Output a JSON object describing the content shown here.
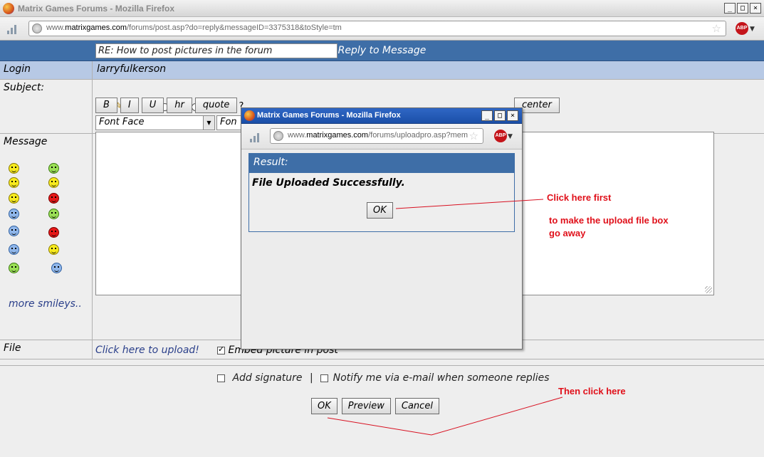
{
  "window": {
    "title": "Matrix Games Forums - Mozilla Firefox",
    "url_prefix": "www.",
    "url_domain": "matrixgames.com",
    "url_path": "/forums/post.asp?do=reply&messageID=3375318&toStyle=tm",
    "min_label": "_",
    "max_label": "□",
    "close_label": "×",
    "star_icon": "star-icon",
    "abp_label": "ABP"
  },
  "header": {
    "title": "Reply to Message"
  },
  "form": {
    "login_label": "Login",
    "login_value": "larryfulkerson",
    "subject_label": "Subject:",
    "subject_value": "RE: How to post pictures in the forum",
    "message_label": "Message",
    "toolbar": {
      "bold": "B",
      "italic": "I",
      "underline": "U",
      "hr": "hr",
      "quote": "quote",
      "center": "center"
    },
    "font_face": "Font Face",
    "font_size_partial": "Fon",
    "more_smileys": "more smileys..",
    "file_label": "File",
    "upload_link": "Click here to upload!",
    "embed_label": "Embed picture in post",
    "embed_checked": true,
    "signature_label": "Add signature",
    "separator": "|",
    "notify_label": "Notify me via e-mail when someone replies",
    "ok": "OK",
    "preview": "Preview",
    "cancel": "Cancel"
  },
  "popup": {
    "title": "Matrix Games Forums - Mozilla Firefox",
    "url_prefix": "www.",
    "url_domain": "matrixgames.com",
    "url_path": "/forums/uploadpro.asp?mem",
    "result_header": "Result:",
    "result_message": "File Uploaded Successfully.",
    "ok": "OK"
  },
  "annotations": {
    "first": "Click here first",
    "line1": "to make the upload file box",
    "line2": "go away",
    "then": "Then click here",
    "color": "#e0101a"
  },
  "colors": {
    "header_blue": "#3e6ea7",
    "login_row": "#b7c9e5",
    "link": "#2a3f8a"
  }
}
